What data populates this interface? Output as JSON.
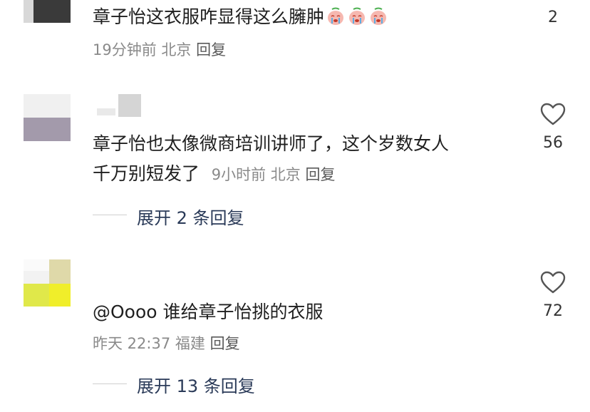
{
  "comments": [
    {
      "text": "章子怡这衣服咋显得这么臃肿",
      "emoji_names": [
        "crying-face-icon",
        "crying-face-icon",
        "crying-face-icon"
      ],
      "time": "19分钟前",
      "location": "北京",
      "reply_label": "回复",
      "like_count": "2"
    },
    {
      "text_line1": "章子怡也太像微商培训讲师了，这个岁数女人",
      "text_line2": "千万别短发了",
      "time": "9小时前",
      "location": "北京",
      "reply_label": "回复",
      "like_count": "56",
      "expand_label": "展开 2 条回复"
    },
    {
      "text": "@Oooo 谁给章子怡挑的衣服",
      "time": "昨天 22:37",
      "location": "福建",
      "reply_label": "回复",
      "like_count": "72",
      "expand_label": "展开 13 条回复"
    }
  ],
  "colors": {
    "text": "#1f1f1f",
    "meta": "#8a8a8a",
    "expand": "#2a3a58",
    "heart_outline": "#555555"
  }
}
